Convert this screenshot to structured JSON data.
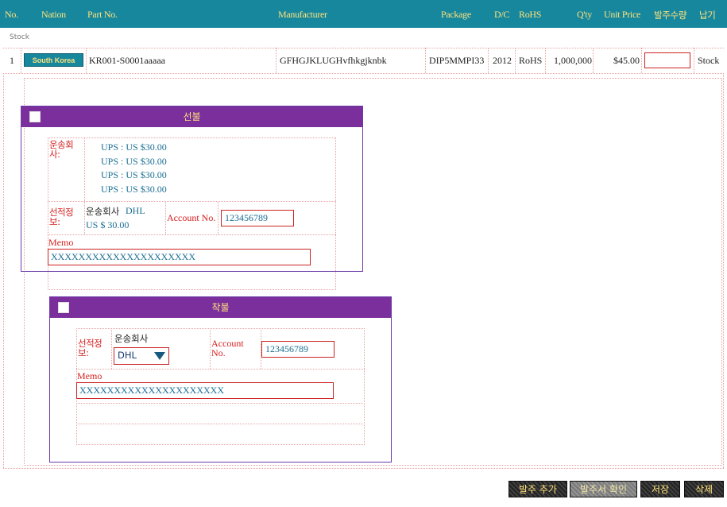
{
  "header": {
    "no": "No.",
    "nation": "Nation",
    "part_no": "Part No.",
    "manufacturer": "Manufacturer",
    "package": "Package",
    "dc": "D/C",
    "rohs": "RoHS",
    "qty": "Q'ty",
    "unit_price": "Unit Price",
    "order_qty": "발주수량",
    "lead_time": "납기"
  },
  "sub_label": "Stock",
  "row": {
    "no": "1",
    "nation": "South Korea",
    "part_no": "KR001-S0001aaaaa",
    "manufacturer": "GFHGJKLUGHvfhkgjknbk",
    "package": "DIP5MMPI33",
    "dc": "2012",
    "rohs": "RoHS",
    "qty": "1,000,000",
    "unit_price": "$45.00",
    "order_qty_value": "",
    "lead_time": "Stock"
  },
  "prepaid": {
    "title": "선불",
    "carrier_label": "운송회사:",
    "carrier_options": [
      "UPS : US $30.00",
      "UPS : US $30.00",
      "UPS : US $30.00",
      "UPS : US $30.00"
    ],
    "shipping_info_label": "선적정보:",
    "carrier_prefix": "운송회사",
    "carrier_name": "DHL",
    "carrier_price": "US $ 30.00",
    "account_label": "Account No.",
    "account_value": "123456789",
    "memo_label": "Memo",
    "memo_value": "XXXXXXXXXXXXXXXXXXXXX"
  },
  "collect": {
    "title": "착불",
    "shipping_info_label": "선적정보:",
    "carrier_prefix": "운송회사",
    "carrier_selected": "DHL",
    "account_label": "Account No.",
    "account_value": "123456789",
    "memo_label": "Memo",
    "memo_value": "XXXXXXXXXXXXXXXXXXXXX"
  },
  "buttons": {
    "add_order": "발주 추가",
    "confirm_order": "발주서 확인",
    "save": "저장",
    "delete": "삭제"
  },
  "colors": {
    "header_bg": "#17879e",
    "header_text": "#ffe27a",
    "panel_head": "#7b2f9c",
    "label_red": "#d62020",
    "value_teal": "#1a6e93"
  }
}
